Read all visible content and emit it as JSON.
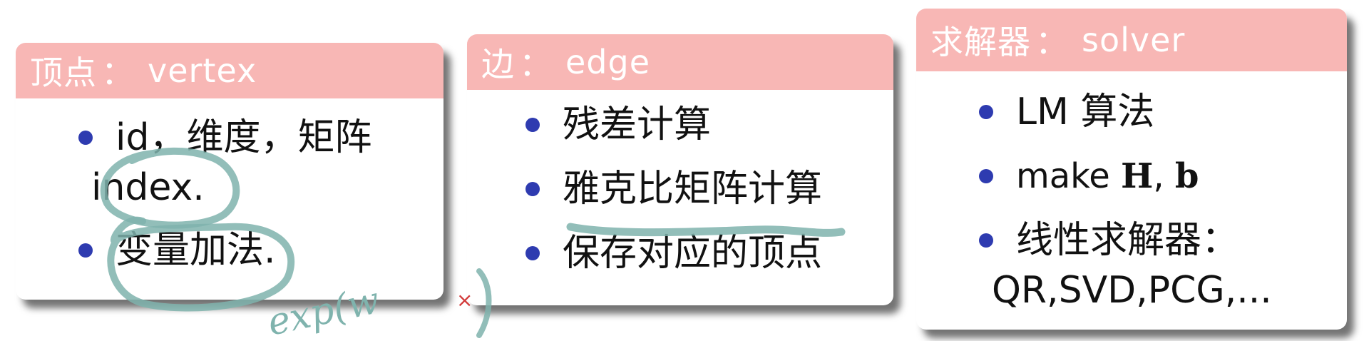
{
  "boxes": {
    "vertex": {
      "title_cn": "顶点",
      "colon": "：",
      "title_en": "vertex",
      "items": [
        {
          "line1": "id，维度，矩阵",
          "line2": "index."
        },
        {
          "line1": "变量加法."
        }
      ]
    },
    "edge": {
      "title_cn": "边",
      "colon": "：",
      "title_en": "edge",
      "items": [
        {
          "line1": "残差计算"
        },
        {
          "line1": "雅克比矩阵计算"
        },
        {
          "line1": "保存对应的顶点"
        }
      ]
    },
    "solver": {
      "title_cn": "求解器",
      "colon": "：",
      "title_en": "solver",
      "items": [
        {
          "line1": "LM 算法"
        },
        {
          "prefix": "make ",
          "bold1": "H",
          "mid": ", ",
          "bold2": "b"
        },
        {
          "line1": "线性求解器：",
          "line2": "QR,SVD,PCG,..."
        }
      ]
    }
  },
  "annotation": {
    "handwriting": "exp(w",
    "cross_mark": "×",
    "ink_color": "#7fb3ad",
    "cross_color": "#d23a3a"
  },
  "colors": {
    "header_bg": "#f8b7b5",
    "bullet": "#2e3bb0"
  }
}
